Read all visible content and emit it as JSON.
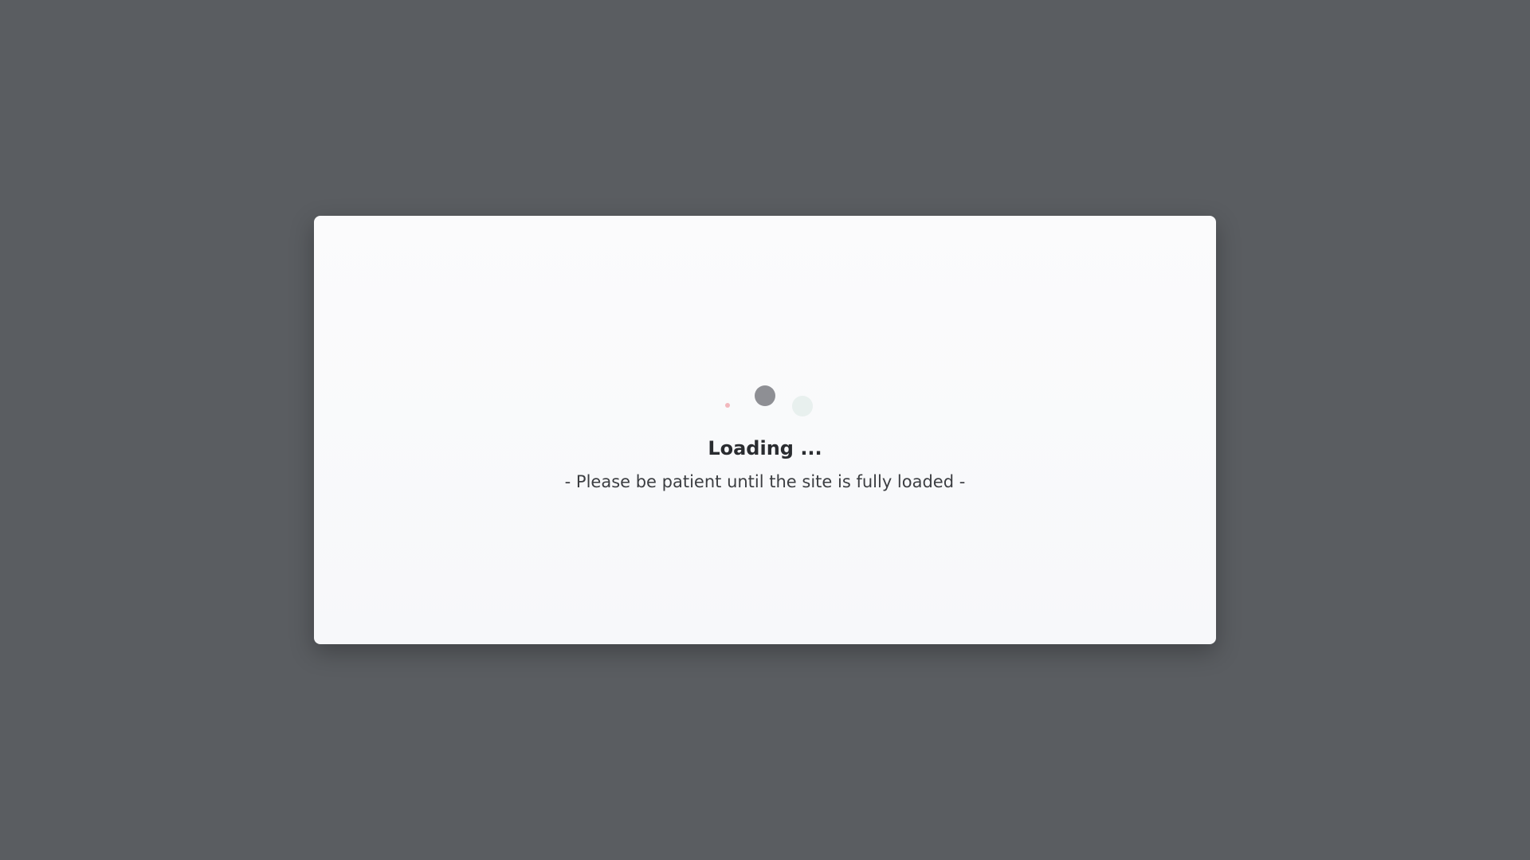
{
  "loader": {
    "title": "Loading ...",
    "subtitle": "- Please be patient until the site is fully loaded -",
    "dots": [
      {
        "name": "small",
        "color": "#f2b8bd"
      },
      {
        "name": "main",
        "color": "#8e8f94"
      },
      {
        "name": "faint",
        "color": "#e8f0ee"
      }
    ]
  },
  "colors": {
    "overlay": "#5a5d61",
    "dialog": "#f8f9fa",
    "text": "#2a2c30"
  }
}
